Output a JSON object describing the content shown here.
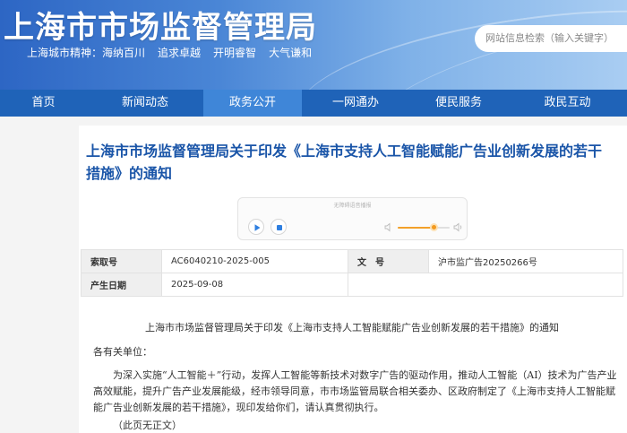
{
  "header": {
    "site_title": "上海市市场监督管理局",
    "spirit_label": "上海城市精神：",
    "spirit_items": [
      "海纳百川",
      "追求卓越",
      "开明睿智",
      "大气谦和"
    ],
    "search_placeholder": "网站信息检索（输入关键字）"
  },
  "nav": {
    "items": [
      "首页",
      "新闻动态",
      "政务公开",
      "一网通办",
      "便民服务",
      "政民互动"
    ],
    "active": "政务公开"
  },
  "article": {
    "title": "上海市市场监督管理局关于印发《上海市支持人工智能赋能广告业创新发展的若干措施》的通知",
    "player_label": "无障碍语音播报",
    "volume_level": 0.72,
    "meta": {
      "index_label": "索取号",
      "index_value": "AC6040210-2025-005",
      "doc_no_label": "文　号",
      "doc_no_value": "沪市监广告20250266号",
      "date_label": "产生日期",
      "date_value": "2025-09-08"
    },
    "body_heading": "上海市市场监督管理局关于印发《上海市支持人工智能赋能广告业创新发展的若干措施》的通知",
    "salutation": "各有关单位：",
    "paragraph": "为深入实施“人工智能＋”行动，发挥人工智能等新技术对数字广告的驱动作用，推动人工智能（AI）技术为广告产业高效赋能，提升广告产业发展能级，经市领导同意，市市场监管局联合相关委办、区政府制定了《上海市支持人工智能赋能广告业创新发展的若干措施》，现印发给你们，请认真贯彻执行。",
    "note": "（此页无正文）"
  },
  "colors": {
    "nav_bg": "#1f63b8",
    "nav_active": "#3f86d8",
    "title_color": "#1a55a8",
    "volume_accent": "#f39a1f"
  }
}
